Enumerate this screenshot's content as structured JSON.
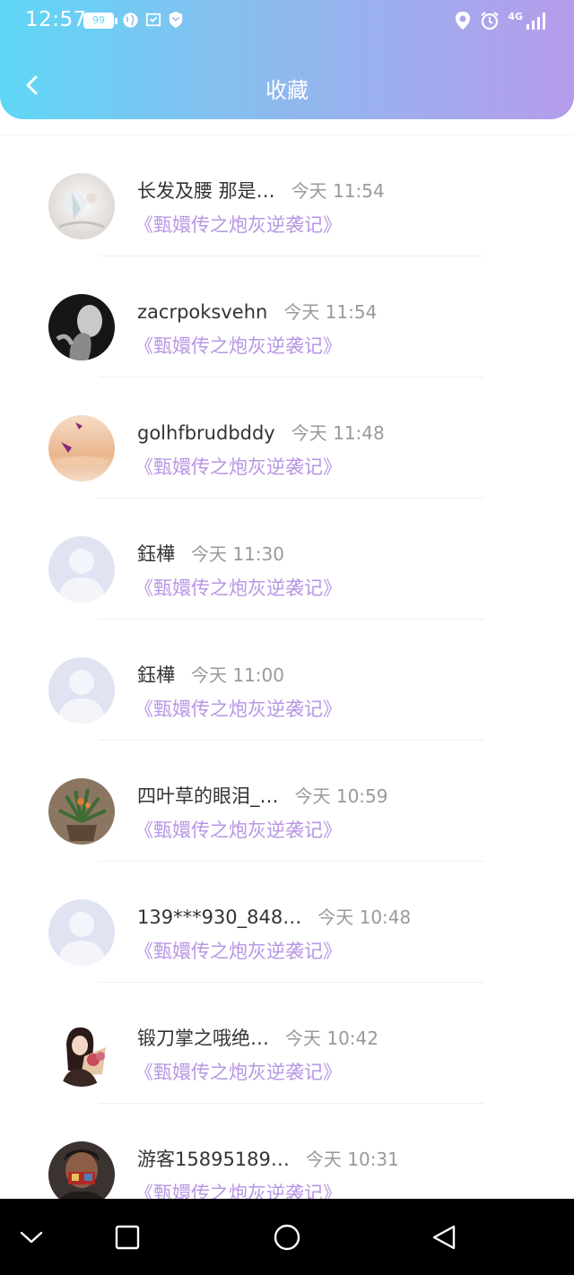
{
  "status_bar": {
    "time": "12:57",
    "battery": "99",
    "network": "4G"
  },
  "header": {
    "title": "收藏",
    "background_colors": [
      "#5fd7f6",
      "#b69cec"
    ]
  },
  "accent_color": "#b896e4",
  "items": [
    {
      "name": "长发及腰 那是…",
      "time": "今天 11:54",
      "work": "《甄嬛传之炮灰逆袭记》",
      "avatar": "crystal-photo"
    },
    {
      "name": "zacrpoksvehn",
      "time": "今天 11:54",
      "work": "《甄嬛传之炮灰逆袭记》",
      "avatar": "dark-portrait"
    },
    {
      "name": "golhfbrudbddy",
      "time": "今天 11:48",
      "work": "《甄嬛传之炮灰逆袭记》",
      "avatar": "paper-crane"
    },
    {
      "name": "鈺樺",
      "time": "今天 11:30",
      "work": "《甄嬛传之炮灰逆袭记》",
      "avatar": "default-user"
    },
    {
      "name": "鈺樺",
      "time": "今天 11:00",
      "work": "《甄嬛传之炮灰逆袭记》",
      "avatar": "default-user"
    },
    {
      "name": "四叶草的眼泪_…",
      "time": "今天 10:59",
      "work": "《甄嬛传之炮灰逆袭记》",
      "avatar": "potted-plant"
    },
    {
      "name": "139***930_848…",
      "time": "今天 10:48",
      "work": "《甄嬛传之炮灰逆袭记》",
      "avatar": "default-user"
    },
    {
      "name": "锻刀掌之哦绝…",
      "time": "今天 10:42",
      "work": "《甄嬛传之炮灰逆袭记》",
      "avatar": "flower-girl"
    },
    {
      "name": "游客15895189…",
      "time": "今天 10:31",
      "work": "《甄嬛传之炮灰逆袭记》",
      "avatar": "person-photo"
    }
  ],
  "system_nav": [
    "collapse-icon",
    "recents-icon",
    "home-icon",
    "back-icon"
  ]
}
